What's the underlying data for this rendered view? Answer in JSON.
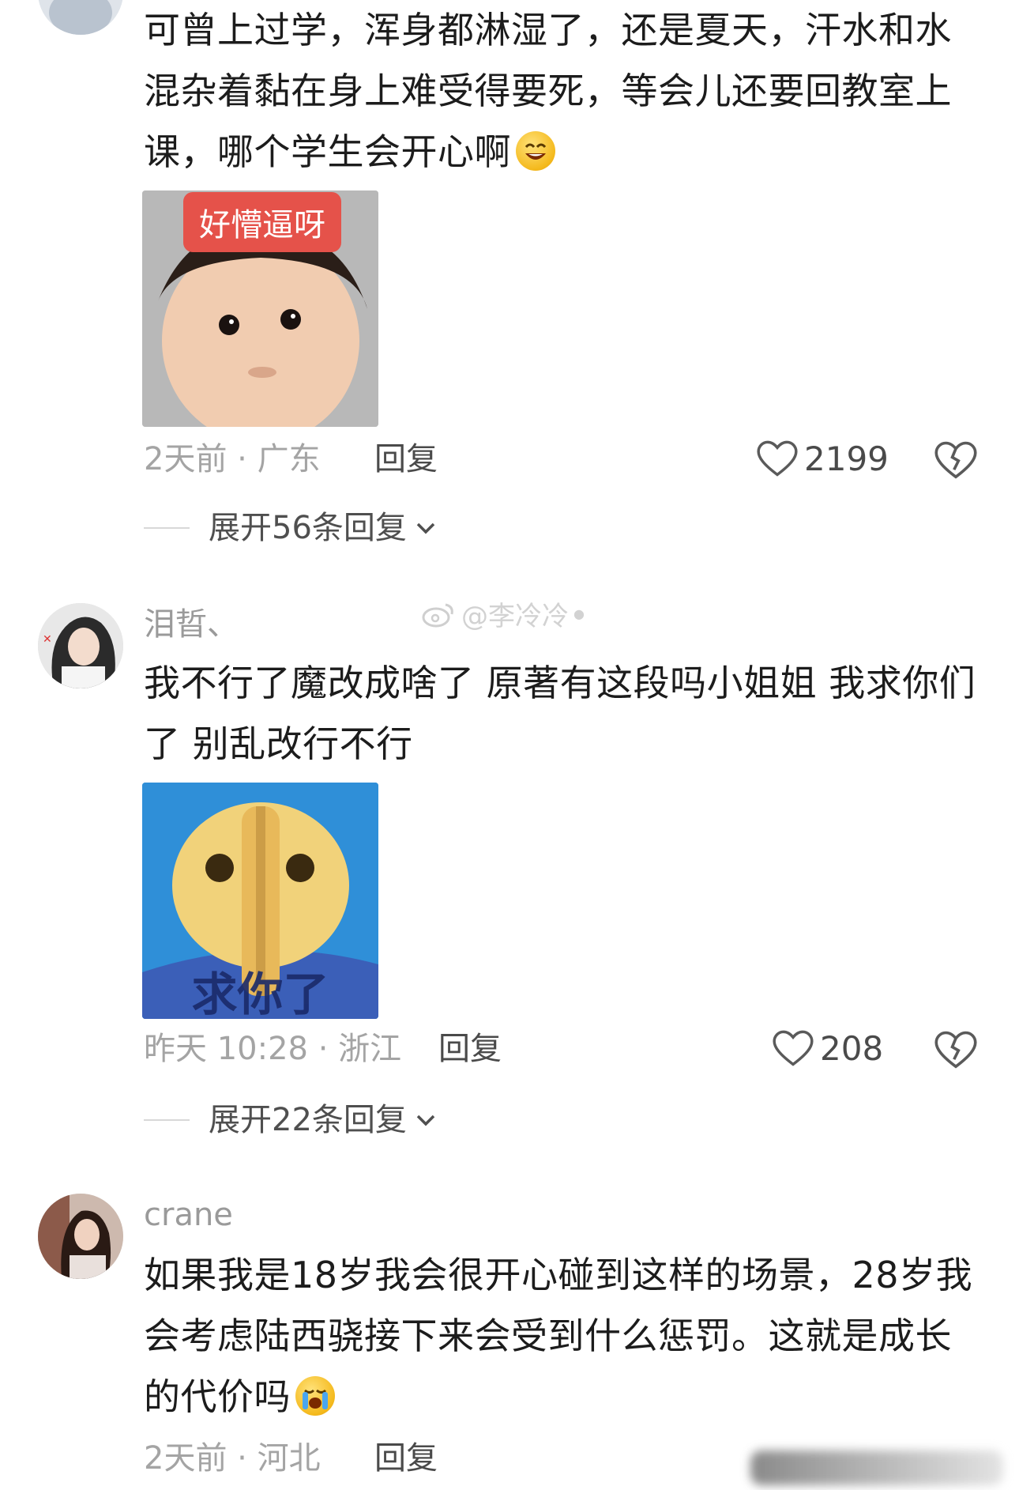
{
  "comments": [
    {
      "username": "",
      "text": "可曾上过学，浑身都淋湿了，还是夏天，汗水和水混杂着黏在身上难受得要死，等会儿还要回教室上课，哪个学生会开心啊",
      "trailing_emoji": "smiling-emoji",
      "sticker_caption": "好懵逼呀",
      "time": "2天前",
      "location": "广东",
      "reply_label": "回复",
      "likes": "2199",
      "expand_label": "展开56条回复"
    },
    {
      "username": "泪晢、",
      "text": "我不行了魔改成啥了 原著有这段吗小姐姐 我求你们了 别乱改行不行",
      "sticker_caption": "求你了",
      "time": "昨天 10:28",
      "location": "浙江",
      "reply_label": "回复",
      "likes": "208",
      "expand_label": "展开22条回复"
    },
    {
      "username": "crane",
      "text": "如果我是18岁我会很开心碰到这样的场景，28岁我会考虑陆西骁接下来会受到什么惩罚。这就是成长的代价吗",
      "trailing_emoji": "crying-emoji",
      "time": "2天前",
      "location": "河北",
      "reply_label": "回复"
    }
  ],
  "watermark": "@李冷冷",
  "separator": "·",
  "colors": {
    "text": "#1c1c1c",
    "meta": "#a4a4a4",
    "sticker1_label_bg": "#e5524a",
    "sticker2_bg": "#2f8fd8"
  }
}
